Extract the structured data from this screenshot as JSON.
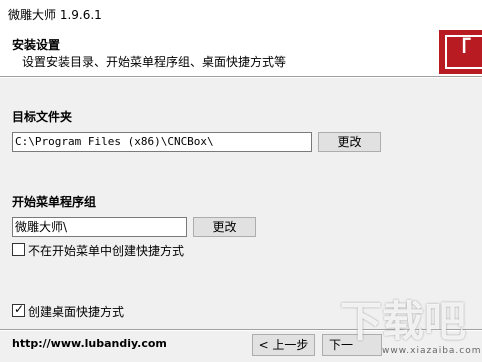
{
  "window": {
    "title": "微雕大师 1.9.6.1"
  },
  "header": {
    "title": "安装设置",
    "subtitle": "设置安装目录、开始菜单程序组、桌面快捷方式等",
    "logo_char": "「"
  },
  "target_folder": {
    "label": "目标文件夹",
    "path": "C:\\Program Files (x86)\\CNCBox\\",
    "change_label": "更改"
  },
  "start_menu": {
    "label": "开始菜单程序组",
    "group": "微雕大师\\",
    "change_label": "更改",
    "no_shortcut_label": "不在开始菜单中创建快捷方式",
    "no_shortcut_checked": false
  },
  "desktop": {
    "shortcut_label": "创建桌面快捷方式",
    "shortcut_checked": true
  },
  "footer": {
    "url": "http://www.lubandiy.com",
    "back_label": "< 上一步",
    "next_label": "下一"
  },
  "watermark": {
    "text": "下载吧",
    "sub": "www.xiazaiba.com"
  }
}
